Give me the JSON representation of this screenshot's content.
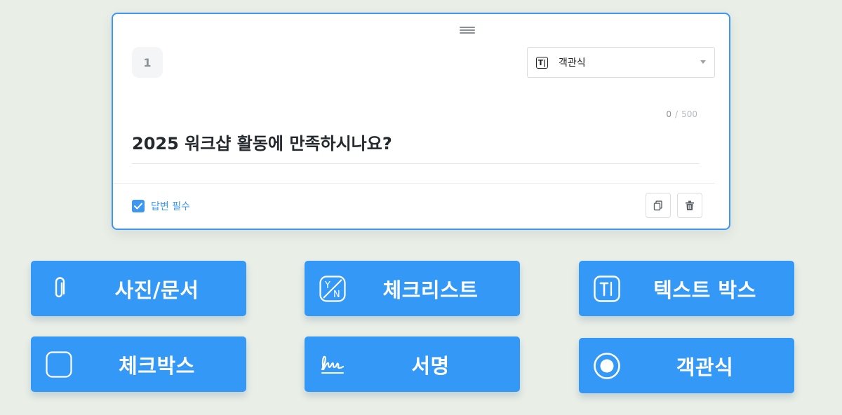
{
  "question_card": {
    "number": "1",
    "type_select": {
      "value": "객관식",
      "icon": "text-box-icon"
    },
    "char_counter": {
      "current": "0",
      "separator": "/",
      "max": "500"
    },
    "question_text": "2025 워크샵 활동에 만족하시나요?",
    "required": {
      "label": "답변 필수",
      "checked": true
    },
    "actions": {
      "copy_icon": "copy-icon",
      "delete_icon": "trash-icon"
    }
  },
  "type_buttons": [
    {
      "label": "사진/문서",
      "icon": "paperclip-icon"
    },
    {
      "label": "체크리스트",
      "icon": "yes-no-icon"
    },
    {
      "label": "텍스트 박스",
      "icon": "text-box-icon"
    },
    {
      "label": "체크박스",
      "icon": "square-icon"
    },
    {
      "label": "서명",
      "icon": "signature-icon"
    },
    {
      "label": "객관식",
      "icon": "radio-icon"
    }
  ],
  "colors": {
    "accent": "#3498f6",
    "card_border": "#3d97f2",
    "background": "#e9eee7"
  }
}
